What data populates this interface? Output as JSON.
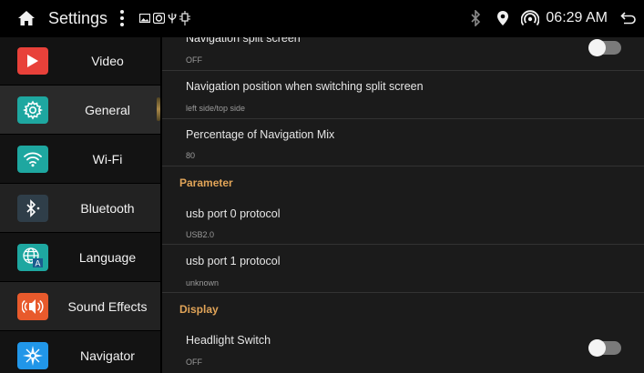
{
  "status_bar": {
    "title": "Settings",
    "time": "06:29 AM"
  },
  "sidebar": {
    "items": [
      {
        "label": "Video",
        "icon": "play-icon",
        "color": "#e8413a"
      },
      {
        "label": "General",
        "icon": "gear-icon",
        "color": "#1ea7a0"
      },
      {
        "label": "Wi-Fi",
        "icon": "wifi-icon",
        "color": "#1ea7a0"
      },
      {
        "label": "Bluetooth",
        "icon": "bluetooth-icon",
        "color": "#2f3e49"
      },
      {
        "label": "Language",
        "icon": "globe-icon",
        "color": "#1ea7a0"
      },
      {
        "label": "Sound Effects",
        "icon": "speaker-icon",
        "color": "#e85a2c"
      },
      {
        "label": "Navigator",
        "icon": "compass-icon",
        "color": "#2196e8"
      }
    ],
    "active": "General"
  },
  "settings": {
    "split_screen": {
      "title": "Navigation split screen",
      "value": "OFF",
      "toggle_on": false
    },
    "nav_position": {
      "title": "Navigation position when switching split screen",
      "value": "left side/top side"
    },
    "nav_mix": {
      "title": "Percentage of Navigation Mix",
      "value": "80"
    },
    "parameter_header": "Parameter",
    "usb0": {
      "title": "usb port 0 protocol",
      "value": "USB2.0"
    },
    "usb1": {
      "title": "usb port 1 protocol",
      "value": "unknown"
    },
    "display_header": "Display",
    "headlight": {
      "title": "Headlight Switch",
      "value": "OFF",
      "toggle_on": false
    }
  },
  "colors": {
    "accent_section": "#e1a458",
    "panel_bg": "#1b1b1b"
  }
}
